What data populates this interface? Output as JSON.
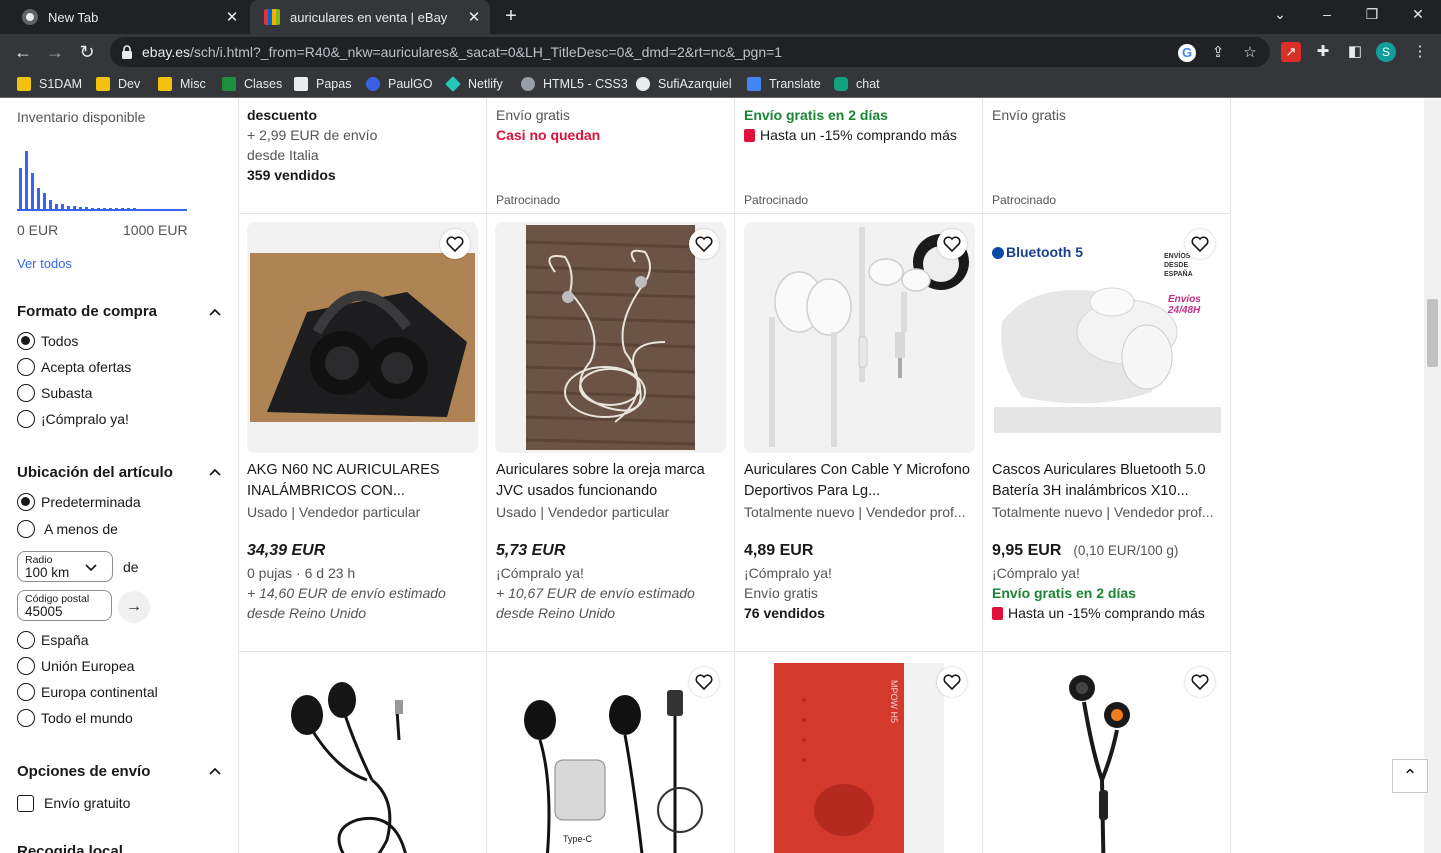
{
  "browser": {
    "tabs": [
      {
        "label": "New Tab",
        "active": false
      },
      {
        "label": "auriculares en venta | eBay",
        "active": true
      }
    ],
    "url_host": "ebay.es",
    "url_path": "/sch/i.html?_from=R40&_nkw=auriculares&_sacat=0&LH_TitleDesc=0&_dmd=2&rt=nc&_pgn=1",
    "profile_initial": "S",
    "bookmarks": [
      "S1DAM",
      "Dev",
      "Misc",
      "Clases",
      "Papas",
      "PaulGO",
      "Netlify",
      "HTML5 - CSS3",
      "SufiAzarquiel",
      "Translate",
      "chat"
    ]
  },
  "sidebar": {
    "inventory_label": "Inventario disponible",
    "histogram": [
      0.62,
      0.88,
      0.55,
      0.32,
      0.24,
      0.13,
      0.08,
      0.07,
      0.05,
      0.04,
      0.03,
      0.03,
      0.02,
      0.02,
      0.02,
      0.02,
      0.01,
      0.01,
      0.01,
      0.01
    ],
    "range_min": "0 EUR",
    "range_max": "1000 EUR",
    "see_all": "Ver todos",
    "format_title": "Formato de compra",
    "format_options": [
      "Todos",
      "Acepta ofertas",
      "Subasta",
      "¡Cómpralo ya!"
    ],
    "location_title": "Ubicación del artículo",
    "location_default": "Predeterminada",
    "location_within": "A menos de",
    "radius_label": "Radio",
    "radius_value": "100 km",
    "of_label": "de",
    "postal_label": "Código postal",
    "postal_value": "45005",
    "location_options": [
      "España",
      "Unión Europea",
      "Europa continental",
      "Todo el mundo"
    ],
    "shipping_title": "Opciones de envío",
    "free_shipping": "Envío gratuito",
    "local_pickup": "Recogida local"
  },
  "top_row": [
    {
      "lines": [
        "descuento",
        "+ 2,99 EUR de envío",
        "desde Italia",
        "359 vendidos"
      ]
    },
    {
      "lines": [
        "Envío gratis",
        "Casi no quedan"
      ],
      "sponsored": "Patrocinado"
    },
    {
      "lines": [
        "Envío gratis en 2 días",
        "Hasta un -15% comprando más"
      ],
      "sponsored": "Patrocinado"
    },
    {
      "lines": [
        "Envío gratis"
      ],
      "sponsored": "Patrocinado"
    }
  ],
  "items": [
    {
      "title": "AKG N60 NC AURICULARES INALÁMBRICOS CON...",
      "condition": "Usado | Vendedor particular",
      "price": "34,39 EUR",
      "l1": "0 pujas · 6 d 23 h",
      "l2": "+ 14,60 EUR de envío estimado",
      "l3": "desde Reino Unido"
    },
    {
      "title": "Auriculares sobre la oreja marca JVC usados funcionando",
      "condition": "Usado | Vendedor particular",
      "price": "5,73 EUR",
      "l1": "¡Cómpralo ya!",
      "l2": "+ 10,67 EUR de envío estimado",
      "l3": "desde Reino Unido"
    },
    {
      "title": "Auriculares Con Cable Y Microfono Deportivos Para Lg...",
      "condition": "Totalmente nuevo | Vendedor prof...",
      "price": "4,89 EUR",
      "l1": "¡Cómpralo ya!",
      "l2": "Envío gratis",
      "l3": "76 vendidos"
    },
    {
      "title": "Cascos Auriculares Bluetooth 5.0 Batería 3H inalámbricos X10...",
      "condition": "Totalmente nuevo | Vendedor prof...",
      "price": "9,95 EUR",
      "unit_price": "(0,10 EUR/100 g)",
      "l1": "¡Cómpralo ya!",
      "l2": "Envío gratis en 2 días",
      "l3": "Hasta un -15% comprando más"
    }
  ],
  "image_labels": {
    "bluetooth": "Bluetooth 5",
    "spain": "ENVÍOS DESDE ESPAÑA",
    "fast": "Envíos 24/48H",
    "usbc": "Type-C",
    "box": "MPOW H5"
  },
  "colors": {
    "accent": "#3665f3",
    "green": "#1a8533",
    "red": "#e0103a"
  }
}
